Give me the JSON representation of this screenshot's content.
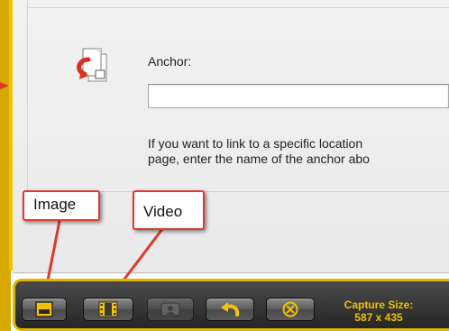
{
  "dialog": {
    "anchor_label": "Anchor:",
    "anchor_value": "",
    "help_line1": "If you want to link to a specific location",
    "help_line2": "page, enter the name of the anchor abo"
  },
  "callouts": {
    "image": "Image",
    "video": "Video"
  },
  "toolbar": {
    "buttons": [
      {
        "name": "image",
        "icon": "image-capture-icon"
      },
      {
        "name": "video",
        "icon": "video-capture-icon"
      },
      {
        "name": "webcam",
        "icon": "webcam-icon",
        "disabled": true
      },
      {
        "name": "undo",
        "icon": "undo-icon"
      },
      {
        "name": "cancel",
        "icon": "close-circle-icon"
      }
    ],
    "capture_size_label": "Capture Size:",
    "capture_size_value": "587 x 435"
  },
  "colors": {
    "frame_yellow": "#e0b400",
    "callout_red": "#e2372b",
    "toolbar_dark": "#333333",
    "capture_text": "#f0c000"
  }
}
